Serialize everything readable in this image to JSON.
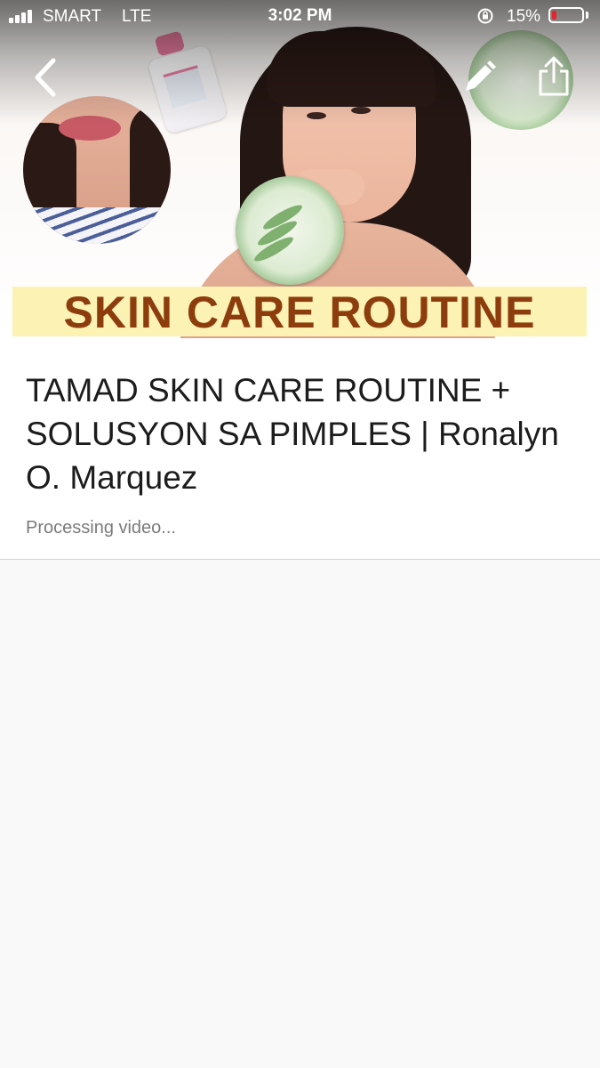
{
  "status_bar": {
    "carrier": "SMART",
    "network": "LTE",
    "time": "3:02 PM",
    "battery_percent": "15%",
    "battery_level": 0.15,
    "battery_color": "#e2262b"
  },
  "hero": {
    "thumbnail_banner": "SKIN CARE ROUTINE",
    "back_icon": "chevron-left-icon",
    "edit_icon": "pencil-icon",
    "share_icon": "share-icon"
  },
  "video": {
    "title": "TAMAD SKIN CARE ROUTINE + SOLUSYON SA PIMPLES | Ronalyn O. Marquez",
    "status": "Processing video..."
  },
  "colors": {
    "banner_text": "#8d3c0d",
    "banner_bg": "#fbf2b3",
    "title_text": "#1c1c1c",
    "status_text": "#7a7a7a",
    "page_bg": "#f9f9f9"
  }
}
